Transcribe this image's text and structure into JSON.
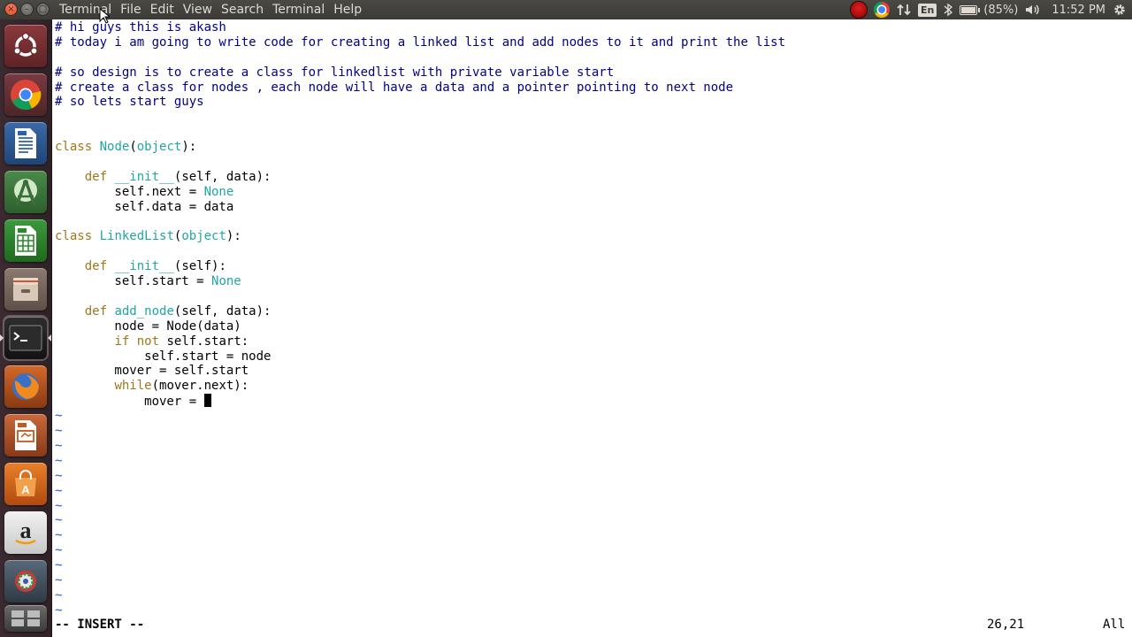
{
  "window": {
    "close_glyph": "×",
    "minimize_glyph": "–",
    "maximize_glyph": "□"
  },
  "menubar": [
    "Terminal",
    "File",
    "Edit",
    "View",
    "Search",
    "Terminal",
    "Help"
  ],
  "tray": {
    "lang": "En",
    "battery": "(85%)",
    "battery_level": 0.85,
    "time": "11:52 PM"
  },
  "launcher": {
    "apps": [
      "ubuntu-dash",
      "chrome",
      "libreoffice-writer",
      "android-studio",
      "libreoffice-calc",
      "files",
      "terminal",
      "firefox",
      "libreoffice-impress",
      "software-center",
      "amazon",
      "system-settings",
      "workspace-switcher"
    ]
  },
  "code": [
    "# hi guys this is akash",
    "# today i am going to write code for creating a linked list and add nodes to it and print the list",
    "",
    "# so design is to create a class for linkedlist with private variable start",
    "# create a class for nodes , each node will have a data and a pointer pointing to next node",
    "# so lets start guys",
    "",
    "",
    "class Node(object):",
    "",
    "    def __init__(self, data):",
    "        self.next = None",
    "        self.data = data",
    "",
    "class LinkedList(object):",
    "",
    "    def __init__(self):",
    "        self.start = None",
    "",
    "    def add_node(self, data):",
    "        node = Node(data)",
    "        if not self.start:",
    "            self.start = node",
    "        mover = self.start",
    "        while(mover.next):",
    "            mover = "
  ],
  "tilde_lines": 14,
  "tilde_char": "~",
  "status": {
    "mode": "-- INSERT --",
    "position": "26,21",
    "scroll": "All"
  },
  "colors": {
    "comment": "#00008b",
    "keyword": "#a0761d",
    "identifier": "#21a5a5",
    "tilde": "#2b58c8",
    "panel": "#3c3b37",
    "launcher": "#2f2226"
  }
}
